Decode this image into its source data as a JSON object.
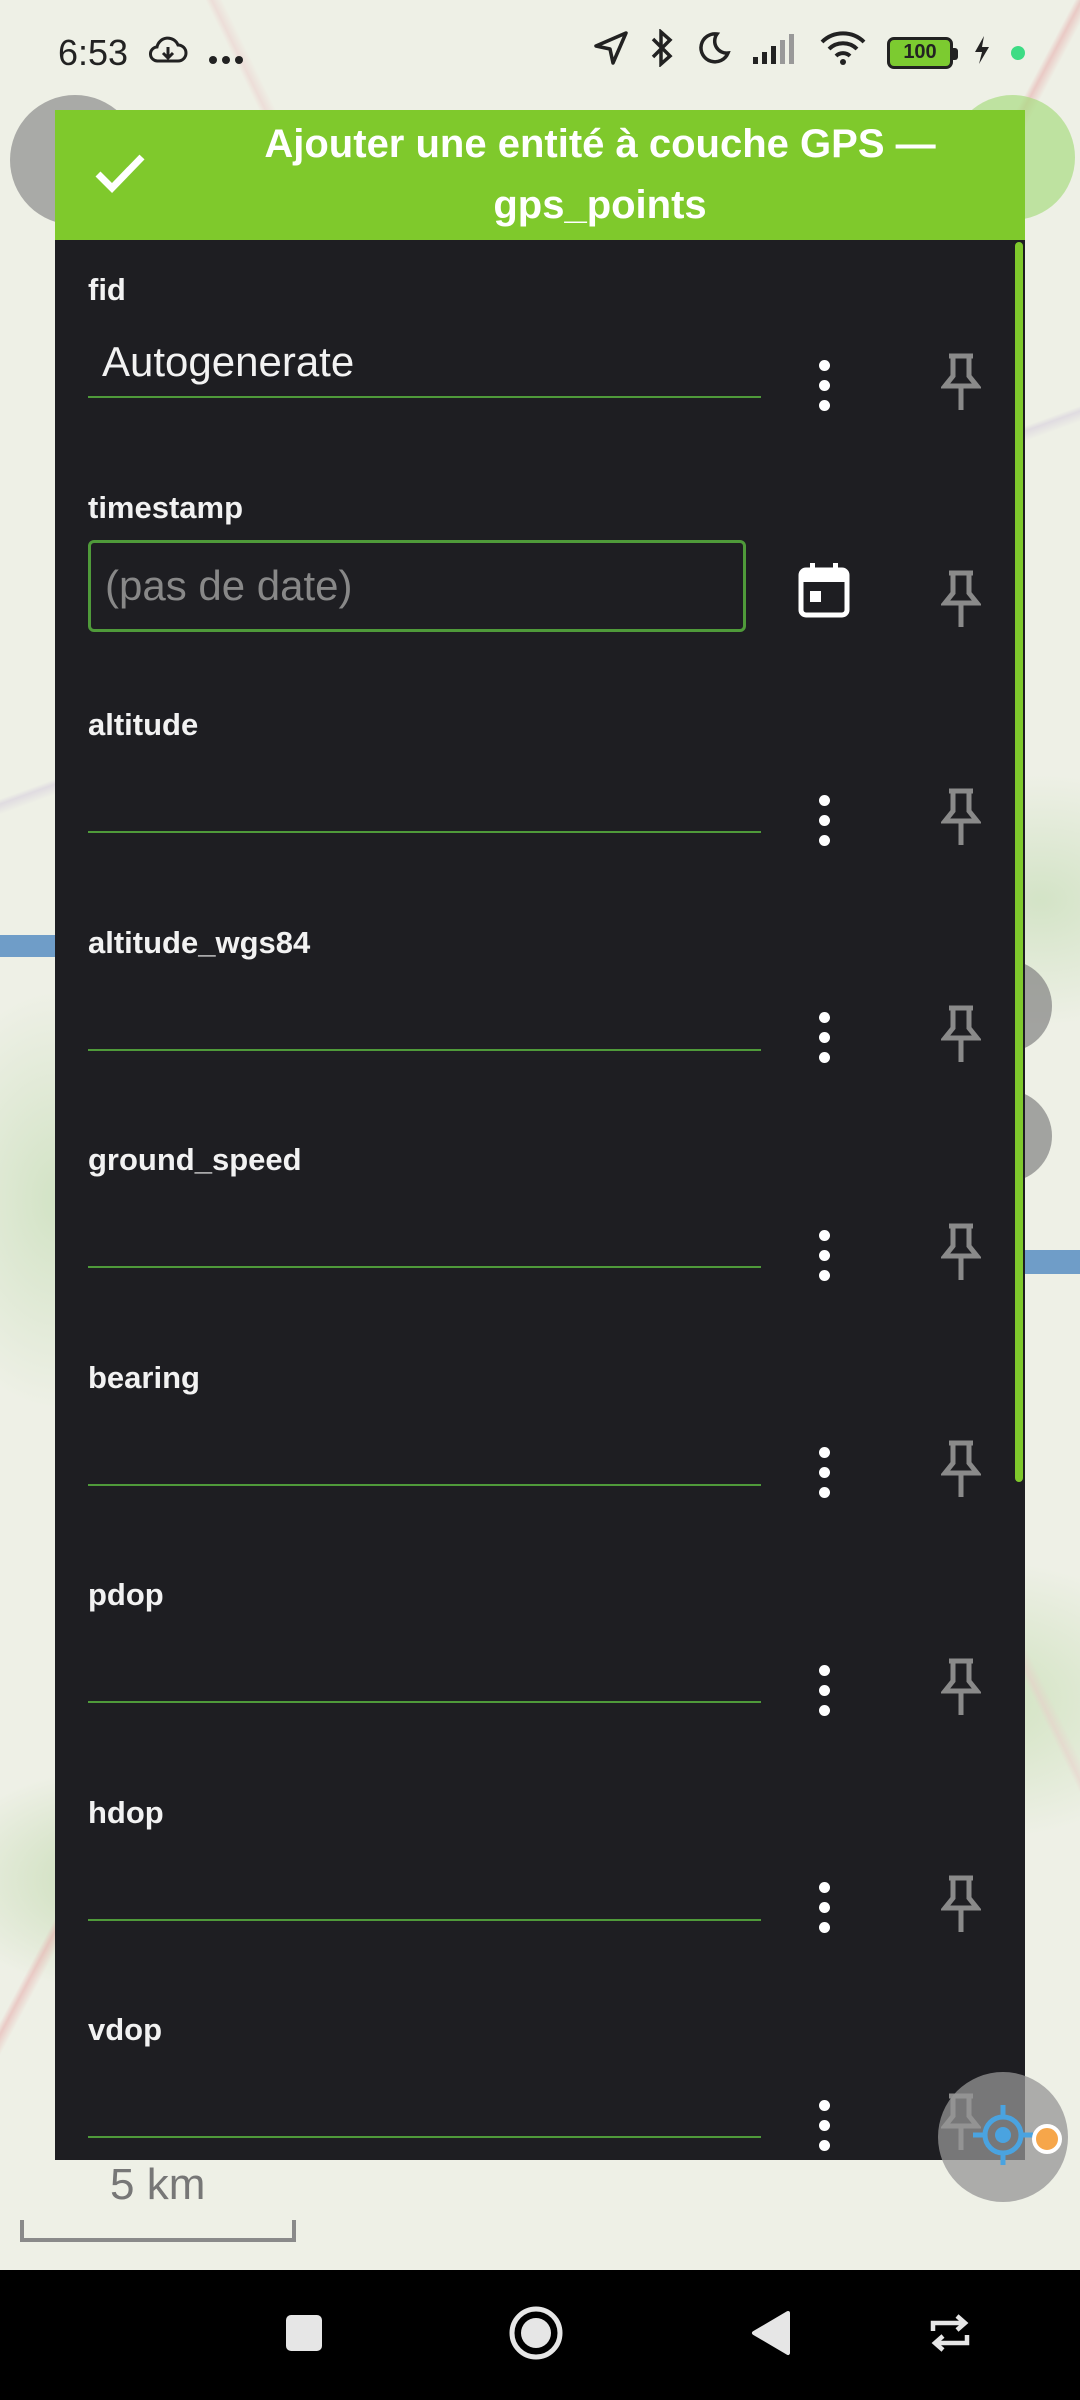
{
  "status_bar": {
    "time": "6:53",
    "battery": "100",
    "icons": [
      "cloud-download-icon",
      "more-icon",
      "location-arrow-icon",
      "bluetooth-icon",
      "do-not-disturb-icon",
      "signal-icon",
      "wifi-icon",
      "battery-icon",
      "charging-icon"
    ]
  },
  "dialog": {
    "title": "Ajouter une entité à couche GPS — gps_points",
    "accent_color": "#7fc92c",
    "fields": [
      {
        "label": "fid",
        "value": "Autogenerate",
        "type": "text"
      },
      {
        "label": "timestamp",
        "value": "(pas de date)",
        "type": "date"
      },
      {
        "label": "altitude",
        "value": "",
        "type": "text"
      },
      {
        "label": "altitude_wgs84",
        "value": "",
        "type": "text"
      },
      {
        "label": "ground_speed",
        "value": "",
        "type": "text"
      },
      {
        "label": "bearing",
        "value": "",
        "type": "text"
      },
      {
        "label": "pdop",
        "value": "",
        "type": "text"
      },
      {
        "label": "hdop",
        "value": "",
        "type": "text"
      },
      {
        "label": "vdop",
        "value": "",
        "type": "text"
      }
    ]
  },
  "map": {
    "scale_label": "5 km"
  },
  "nav_bar": {
    "buttons": [
      "recents-button",
      "home-button",
      "back-button",
      "rotate-button"
    ]
  }
}
